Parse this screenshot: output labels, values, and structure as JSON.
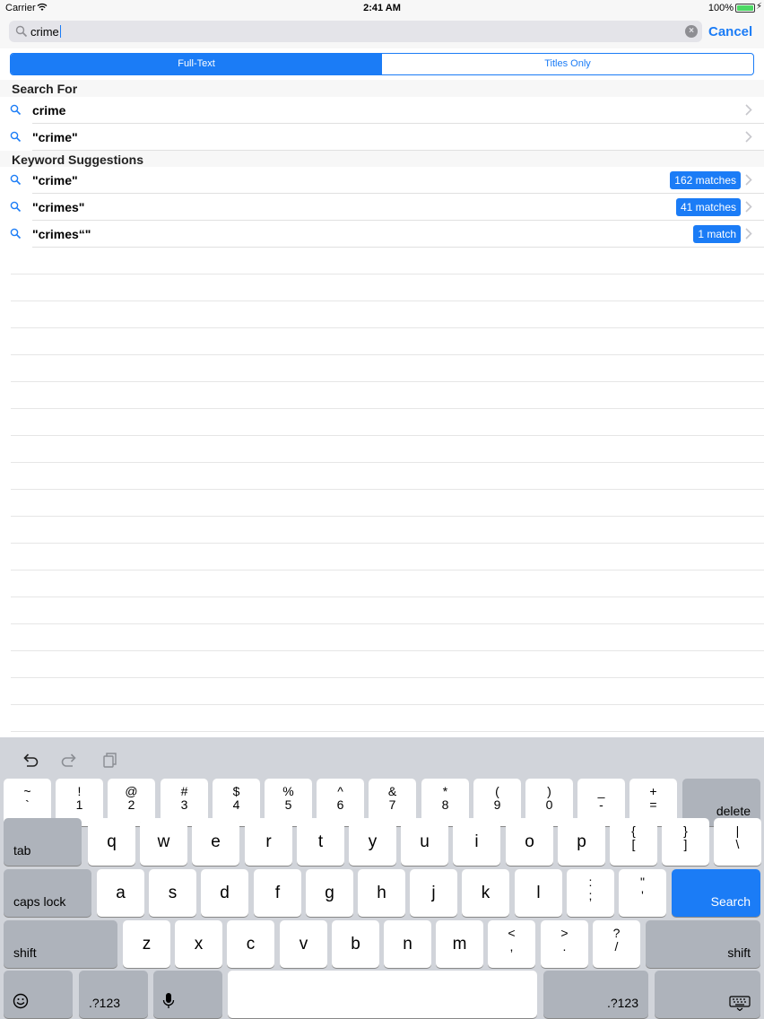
{
  "status_bar": {
    "carrier": "Carrier",
    "time": "2:41 AM",
    "battery": "100%"
  },
  "search": {
    "query": "crime",
    "cancel_label": "Cancel"
  },
  "segments": [
    {
      "label": "Full-Text",
      "selected": true
    },
    {
      "label": "Titles Only",
      "selected": false
    }
  ],
  "sections": {
    "search_for": {
      "header": "Search For",
      "items": [
        {
          "label": "crime"
        },
        {
          "label": "\"crime\""
        }
      ]
    },
    "keyword_suggestions": {
      "header": "Keyword Suggestions",
      "items": [
        {
          "label": "\"crime\"",
          "badge": "162 matches"
        },
        {
          "label": "\"crimes\"",
          "badge": "41 matches"
        },
        {
          "label": "\"crimes“\"",
          "badge": "1 match"
        }
      ]
    }
  },
  "keyboard": {
    "tools": [
      "undo-icon",
      "redo-icon",
      "paste-icon"
    ],
    "number_row": [
      {
        "top": "~",
        "bottom": "`"
      },
      {
        "top": "!",
        "bottom": "1"
      },
      {
        "top": "@",
        "bottom": "2"
      },
      {
        "top": "#",
        "bottom": "3"
      },
      {
        "top": "$",
        "bottom": "4"
      },
      {
        "top": "%",
        "bottom": "5"
      },
      {
        "top": "^",
        "bottom": "6"
      },
      {
        "top": "&",
        "bottom": "7"
      },
      {
        "top": "*",
        "bottom": "8"
      },
      {
        "top": "(",
        "bottom": "9"
      },
      {
        "top": ")",
        "bottom": "0"
      },
      {
        "top": "_",
        "bottom": "-"
      },
      {
        "top": "+",
        "bottom": "="
      }
    ],
    "delete_label": "delete",
    "tab_label": "tab",
    "row_q": [
      "q",
      "w",
      "e",
      "r",
      "t",
      "y",
      "u",
      "i",
      "o",
      "p"
    ],
    "row_q_extra": [
      {
        "top": "{",
        "bottom": "["
      },
      {
        "top": "}",
        "bottom": "]"
      },
      {
        "top": "|",
        "bottom": "\\"
      }
    ],
    "caps_label": "caps lock",
    "row_a": [
      "a",
      "s",
      "d",
      "f",
      "g",
      "h",
      "j",
      "k",
      "l"
    ],
    "row_a_extra": [
      {
        "top": ":",
        "bottom": ";"
      },
      {
        "top": "\"",
        "bottom": "'"
      }
    ],
    "search_label": "Search",
    "shift_label": "shift",
    "row_z": [
      "z",
      "x",
      "c",
      "v",
      "b",
      "n",
      "m"
    ],
    "row_z_extra": [
      {
        "top": "<",
        "bottom": ","
      },
      {
        "top": ">",
        "bottom": "."
      },
      {
        "top": "?",
        "bottom": "/"
      }
    ],
    "numbers_label": ".?123",
    "accent_color": "#1b7cf6"
  }
}
